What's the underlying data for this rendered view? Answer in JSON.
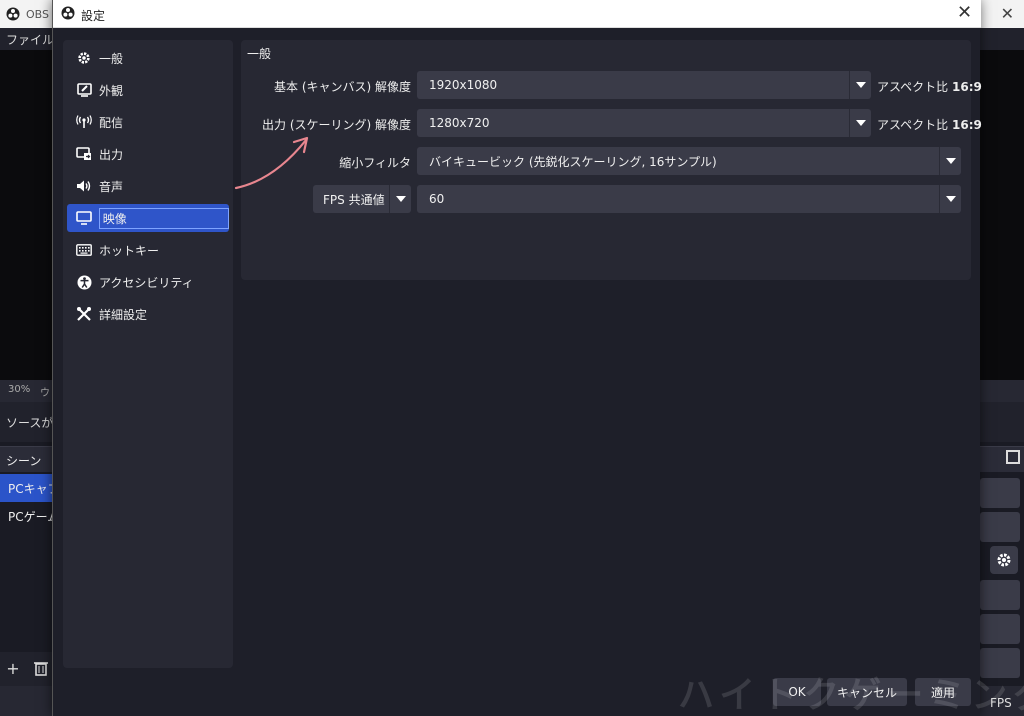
{
  "background_window": {
    "title": "OBS",
    "menu_file": "ファイル(F",
    "zoom": "30%",
    "zoom_extra": "ウ",
    "no_source_text": "ソースが選",
    "scenes_title": "シーン",
    "scenes": [
      "PCキャプ",
      "PCゲーム"
    ],
    "fps_label": "FPS"
  },
  "dialog": {
    "title": "設定",
    "close_glyph": "✕"
  },
  "sidebar": {
    "items": [
      {
        "label": "一般",
        "icon": "gear-icon"
      },
      {
        "label": "外観",
        "icon": "appearance-icon"
      },
      {
        "label": "配信",
        "icon": "broadcast-icon"
      },
      {
        "label": "出力",
        "icon": "output-icon"
      },
      {
        "label": "音声",
        "icon": "speaker-icon"
      },
      {
        "label": "映像",
        "icon": "monitor-icon",
        "active": true
      },
      {
        "label": "ホットキー",
        "icon": "keyboard-icon"
      },
      {
        "label": "アクセシビリティ",
        "icon": "accessibility-icon"
      },
      {
        "label": "詳細設定",
        "icon": "tools-icon"
      }
    ]
  },
  "video": {
    "section_title": "一般",
    "base_resolution_label": "基本 (キャンバス) 解像度",
    "base_resolution_value": "1920x1080",
    "output_resolution_label": "出力 (スケーリング) 解像度",
    "output_resolution_value": "1280x720",
    "aspect_prefix": "アスペクト比",
    "aspect_value": "16:9",
    "downscale_filter_label": "縮小フィルタ",
    "downscale_filter_value": "バイキュービック (先鋭化スケーリング, 16サンプル)",
    "fps_type": "FPS 共通値",
    "fps_value": "60"
  },
  "buttons": {
    "ok": "OK",
    "cancel": "キャンセル",
    "apply": "適用"
  },
  "watermark": "ハイトクゲーミング",
  "colors": {
    "accent": "#2f55c9",
    "annotation_arrow": "#e8868f"
  }
}
